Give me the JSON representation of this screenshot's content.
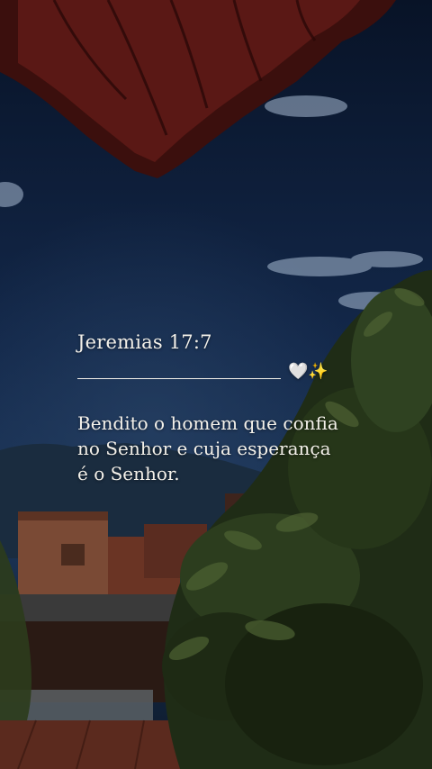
{
  "story": {
    "reference": "Jeremias 17:7",
    "emoji": "🤍✨",
    "verse_lines": [
      "Bendito o homem que confia",
      "no Senhor e cuja esperança",
      "é o Senhor."
    ]
  },
  "colors": {
    "sky_top": "#0a1630",
    "sky_mid": "#13284a",
    "roof_tile": "#4a1210",
    "foliage": "#1d2a14",
    "text": "#f4f1ea"
  }
}
